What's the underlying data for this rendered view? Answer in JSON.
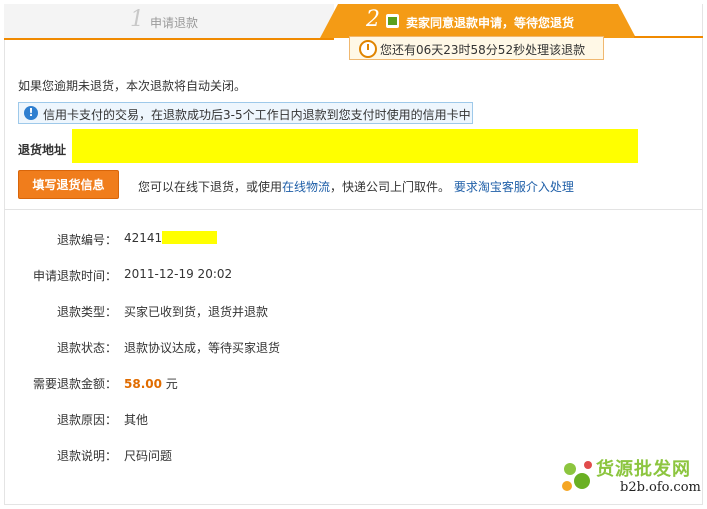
{
  "steps": {
    "step1": {
      "num": "1",
      "label": "申请退款"
    },
    "step2": {
      "num": "2",
      "label": "卖家同意退款申请，等待您退货"
    }
  },
  "timer": {
    "text": "您还有06天23时58分52秒处理该退款"
  },
  "notice": {
    "auto_close": "如果您逾期未退货，本次退款将自动关闭。"
  },
  "info_box": {
    "text": "信用卡支付的交易，在退款成功后3-5个工作日内退款到您支付时使用的信用卡中"
  },
  "return_address": {
    "label": "退货地址"
  },
  "actions": {
    "fill_button": "填写退货信息",
    "help_prefix": "您可以在线下退货，或使用",
    "online_logistics": "在线物流",
    "help_middle": "，快递公司上门取件。",
    "ask_service": "要求淘宝客服介入处理"
  },
  "details": [
    {
      "key": "退款编号：",
      "value": "42141"
    },
    {
      "key": "申请退款时间：",
      "value": "2011-12-19 20:02"
    },
    {
      "key": "退款类型：",
      "value": "买家已收到货，退货并退款"
    },
    {
      "key": "退款状态：",
      "value": "退款协议达成，等待买家退货"
    },
    {
      "key": "需要退款金额：",
      "value_amount": "58.00",
      "value_unit": " 元"
    },
    {
      "key": "退款原因：",
      "value": "其他"
    },
    {
      "key": "退款说明：",
      "value": "尺码问题"
    }
  ],
  "watermark": {
    "title": "货源批发网",
    "url": "b2b.ofo.com"
  },
  "colors": {
    "accent": "#f49b15",
    "button": "#f07d1c",
    "link": "#1f5fa8",
    "amount": "#e06c00",
    "mask": "#ffff00"
  }
}
